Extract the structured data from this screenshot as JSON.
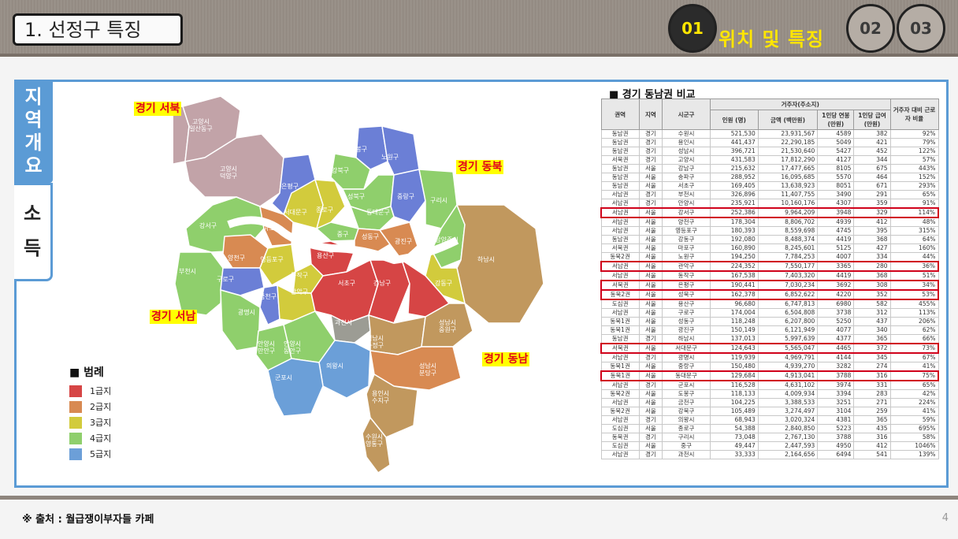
{
  "header": {
    "title": "1. 선정구 특징",
    "steps": [
      "01",
      "02",
      "03"
    ],
    "section_title": "위치 및 특징"
  },
  "side": {
    "tab1": "지역개요",
    "tab2": "소득"
  },
  "map": {
    "region_labels": [
      "경기 서북",
      "경기 동북",
      "경기 서남",
      "경기 동남"
    ],
    "districts": [
      "고양시 일산서구",
      "고양시 일산동구",
      "고양시 덕양구",
      "도봉구",
      "노원구",
      "강북구",
      "은평구",
      "성북구",
      "중랑구",
      "구리시",
      "서대문구",
      "종로구",
      "동대문구",
      "강서구",
      "마포구",
      "중구",
      "성동구",
      "광진구",
      "남양주시",
      "하남시",
      "양천구",
      "영등포구",
      "용산구",
      "동작구",
      "강동구",
      "부천시",
      "구로구",
      "금천구",
      "관악구",
      "서초구",
      "강남구",
      "송파구",
      "광명시",
      "과천시",
      "안양시 만안구",
      "안양시 동안구",
      "성남시 수정구",
      "성남시 중원구",
      "성남시 분당구",
      "의왕시",
      "군포시",
      "용인시 수지구",
      "수원시 영통구"
    ]
  },
  "legend": {
    "title": "■ 범례",
    "items": [
      {
        "label": "1급지",
        "color": "#d64545"
      },
      {
        "label": "2급지",
        "color": "#d88a52"
      },
      {
        "label": "3급지",
        "color": "#d2cb3c"
      },
      {
        "label": "4급지",
        "color": "#8fcf6c"
      },
      {
        "label": "5급지",
        "color": "#6c9fd8"
      }
    ]
  },
  "table": {
    "title": "■ 경기 동남권 비교",
    "headers": {
      "region": "권역",
      "area": "지역",
      "city": "시군구",
      "group": "거주자(주소지)",
      "people": "인원 (명)",
      "amount": "금액 (백만원)",
      "per_year": "1인당 연봉 (만원)",
      "per_month": "1인당 급여 (만원)",
      "ratio": "거주자 대비 근로자 비율"
    },
    "rows": [
      [
        "동남권",
        "경기",
        "수원시",
        "521,530",
        "23,931,567",
        "4589",
        "382",
        "92%"
      ],
      [
        "동남권",
        "경기",
        "용인시",
        "441,437",
        "22,290,185",
        "5049",
        "421",
        "79%"
      ],
      [
        "동남권",
        "경기",
        "성남시",
        "396,721",
        "21,530,640",
        "5427",
        "452",
        "122%"
      ],
      [
        "서북권",
        "경기",
        "고양시",
        "431,583",
        "17,812,290",
        "4127",
        "344",
        "57%"
      ],
      [
        "동남권",
        "서울",
        "강남구",
        "215,632",
        "17,477,665",
        "8105",
        "675",
        "443%"
      ],
      [
        "동남권",
        "서울",
        "송파구",
        "288,952",
        "16,095,685",
        "5570",
        "464",
        "152%"
      ],
      [
        "동남권",
        "서울",
        "서초구",
        "169,405",
        "13,638,923",
        "8051",
        "671",
        "293%"
      ],
      [
        "서남권",
        "경기",
        "부천시",
        "326,896",
        "11,407,755",
        "3490",
        "291",
        "65%"
      ],
      [
        "서남권",
        "경기",
        "안양시",
        "235,921",
        "10,160,176",
        "4307",
        "359",
        "91%"
      ],
      [
        "서남권",
        "서울",
        "강서구",
        "252,386",
        "9,964,209",
        "3948",
        "329",
        "114%"
      ],
      [
        "서남권",
        "서울",
        "양천구",
        "178,304",
        "8,806,702",
        "4939",
        "412",
        "48%"
      ],
      [
        "서남권",
        "서울",
        "영등포구",
        "180,393",
        "8,559,698",
        "4745",
        "395",
        "315%"
      ],
      [
        "동남권",
        "서울",
        "강동구",
        "192,080",
        "8,488,374",
        "4419",
        "368",
        "64%"
      ],
      [
        "서북권",
        "서울",
        "마포구",
        "160,890",
        "8,245,601",
        "5125",
        "427",
        "160%"
      ],
      [
        "동북2권",
        "서울",
        "노원구",
        "194,250",
        "7,784,253",
        "4007",
        "334",
        "44%"
      ],
      [
        "서남권",
        "서울",
        "관악구",
        "224,352",
        "7,550,177",
        "3365",
        "280",
        "36%"
      ],
      [
        "서남권",
        "서울",
        "동작구",
        "167,538",
        "7,403,320",
        "4419",
        "368",
        "51%"
      ],
      [
        "서북권",
        "서울",
        "은평구",
        "190,441",
        "7,030,234",
        "3692",
        "308",
        "34%"
      ],
      [
        "동북2권",
        "서울",
        "성북구",
        "162,378",
        "6,852,622",
        "4220",
        "352",
        "53%"
      ],
      [
        "도심권",
        "서울",
        "용산구",
        "96,680",
        "6,747,813",
        "6980",
        "582",
        "455%"
      ],
      [
        "서남권",
        "서울",
        "구로구",
        "174,004",
        "6,504,808",
        "3738",
        "312",
        "113%"
      ],
      [
        "동북1권",
        "서울",
        "성동구",
        "118,248",
        "6,207,800",
        "5250",
        "437",
        "206%"
      ],
      [
        "동북1권",
        "서울",
        "광진구",
        "150,149",
        "6,121,949",
        "4077",
        "340",
        "62%"
      ],
      [
        "동남권",
        "경기",
        "하남시",
        "137,013",
        "5,997,639",
        "4377",
        "365",
        "66%"
      ],
      [
        "서북권",
        "서울",
        "서대문구",
        "124,643",
        "5,565,047",
        "4465",
        "372",
        "73%"
      ],
      [
        "서남권",
        "경기",
        "광명시",
        "119,939",
        "4,969,791",
        "4144",
        "345",
        "67%"
      ],
      [
        "동북1권",
        "서울",
        "중랑구",
        "150,480",
        "4,939,270",
        "3282",
        "274",
        "41%"
      ],
      [
        "동북1권",
        "서울",
        "동대문구",
        "129,684",
        "4,913,041",
        "3788",
        "316",
        "75%"
      ],
      [
        "서남권",
        "경기",
        "군포시",
        "116,528",
        "4,631,102",
        "3974",
        "331",
        "65%"
      ],
      [
        "동북2권",
        "서울",
        "도봉구",
        "118,133",
        "4,009,934",
        "3394",
        "283",
        "42%"
      ],
      [
        "서남권",
        "서울",
        "금천구",
        "104,225",
        "3,388,533",
        "3251",
        "271",
        "224%"
      ],
      [
        "동북2권",
        "서울",
        "강북구",
        "105,489",
        "3,274,497",
        "3104",
        "259",
        "41%"
      ],
      [
        "서남권",
        "경기",
        "의왕시",
        "68,943",
        "3,020,324",
        "4381",
        "365",
        "59%"
      ],
      [
        "도심권",
        "서울",
        "종로구",
        "54,388",
        "2,840,850",
        "5223",
        "435",
        "695%"
      ],
      [
        "동북권",
        "경기",
        "구리시",
        "73,048",
        "2,767,130",
        "3788",
        "316",
        "58%"
      ],
      [
        "도심권",
        "서울",
        "중구",
        "49,447",
        "2,447,593",
        "4950",
        "412",
        "1046%"
      ],
      [
        "서남권",
        "경기",
        "과천시",
        "33,333",
        "2,164,656",
        "6494",
        "541",
        "139%"
      ]
    ],
    "highlight_rows": [
      9,
      15,
      17,
      18,
      24,
      27
    ]
  },
  "footer": {
    "source": "※ 출처 : 월급쟁이부자들 카페",
    "page": "4"
  }
}
